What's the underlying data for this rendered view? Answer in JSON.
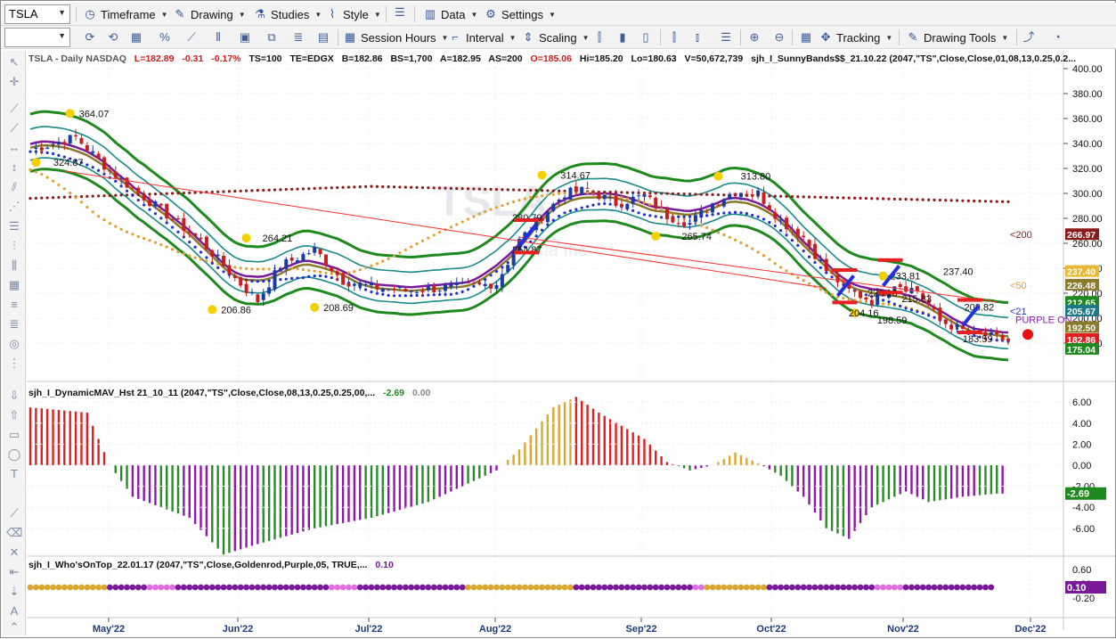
{
  "toolbar1": {
    "symbol": "TSLA",
    "items": [
      {
        "label": "Timeframe",
        "icon": "clock-icon"
      },
      {
        "label": "Drawing",
        "icon": "pencil-icon"
      },
      {
        "label": "Studies",
        "icon": "flask-icon"
      },
      {
        "label": "Style",
        "icon": "style-icon"
      },
      {
        "label": "Data",
        "icon": "database-icon"
      },
      {
        "label": "Settings",
        "icon": "gear-icon"
      }
    ]
  },
  "toolbar2": {
    "items": [
      {
        "label": "Session Hours"
      },
      {
        "label": "Interval"
      },
      {
        "label": "Scaling"
      },
      {
        "label": "Tracking"
      },
      {
        "label": "Drawing Tools"
      }
    ]
  },
  "price_pane": {
    "status": {
      "symbol": "TSLA - Daily  NASDAQ",
      "last": "L=182.89",
      "chg": "-0.31",
      "pct": "-0.17%",
      "ts": "TS=100",
      "te": "TE=EDGX",
      "bid": "B=182.86",
      "bs": "BS=1,700",
      "ask": "A=182.95",
      "as": "AS=200",
      "open": "O=185.06",
      "hi": "Hi=185.20",
      "lo": "Lo=180.63",
      "vol": "V=50,672,739",
      "study": "sjh_I_SunnyBands$$_21.10.22 (2047,\"TS\",Close,Close,01,08,13,0.25,0.2..."
    },
    "watermark": "TSLA",
    "watermark_sub": "Tesla Inc",
    "axis_ticks": [
      "400.00",
      "380.00",
      "360.00",
      "340.00",
      "320.00",
      "300.00",
      "280.00",
      "260.00",
      "240.00",
      "220.00",
      "200.00",
      "180.00"
    ],
    "price_labels": [
      {
        "text": "266.97",
        "color": "#8b1a1a"
      },
      {
        "text": "237.40",
        "color": "#e8b830"
      },
      {
        "text": "226.48",
        "color": "#8a7a2a"
      },
      {
        "text": "212.65",
        "color": "#1e8a1e"
      },
      {
        "text": "205.67",
        "color": "#1a7a8a"
      },
      {
        "text": "192.50",
        "color": "#8a7a2a"
      },
      {
        "text": "182.86",
        "color": "#e02020"
      },
      {
        "text": "175.04",
        "color": "#1e8a1e"
      }
    ],
    "annotations": [
      "364.07",
      "324.87",
      "264.21",
      "206.86",
      "208.69",
      "280.79",
      "254.87",
      "314.67",
      "313.80",
      "265.74",
      "233.81",
      "237.40",
      "220.18",
      "215.83",
      "204.16",
      "198.59",
      "208.82",
      "183.59"
    ],
    "ma_labels": [
      "<200",
      "<50",
      "<21"
    ],
    "purple_on": "PURPLE ON"
  },
  "hist_pane": {
    "title": "sjh_I_DynamicMAV_Hst 21_10_11 (2047,\"TS\",Close,Close,08,13,0.25,0.25,00,...",
    "v1": "-2.69",
    "v2": "0.00",
    "axis_ticks": [
      "6.00",
      "4.00",
      "2.00",
      "0.00",
      "-2.00",
      "-4.00",
      "-6.00"
    ],
    "current_label": "-2.69"
  },
  "dot_pane": {
    "title": "sjh_I_Who'sOnTop_22.01.17 (2047,\"TS\",Close,Goldenrod,Purple,05, TRUE,...",
    "v1": "0.10",
    "axis_ticks": [
      "0.60",
      "0.20",
      "-0.20"
    ],
    "current_label": "0.10"
  },
  "x_axis": [
    "May'22",
    "Jun'22",
    "Jul'22",
    "Aug'22",
    "Sep'22",
    "Oct'22",
    "Nov'22",
    "Dec'22"
  ],
  "colors": {
    "up_candle": "#1a3aa8",
    "down_candle": "#c81e1e",
    "outer_band": "#1e8a1e",
    "inner_band": "#1a8a8a",
    "avg_purple": "#7a1a9a",
    "avg_olive": "#8a7a2a",
    "ma200": "#8b1a1a",
    "ma50": "#e0a030",
    "ma21": "#2030d0"
  }
}
